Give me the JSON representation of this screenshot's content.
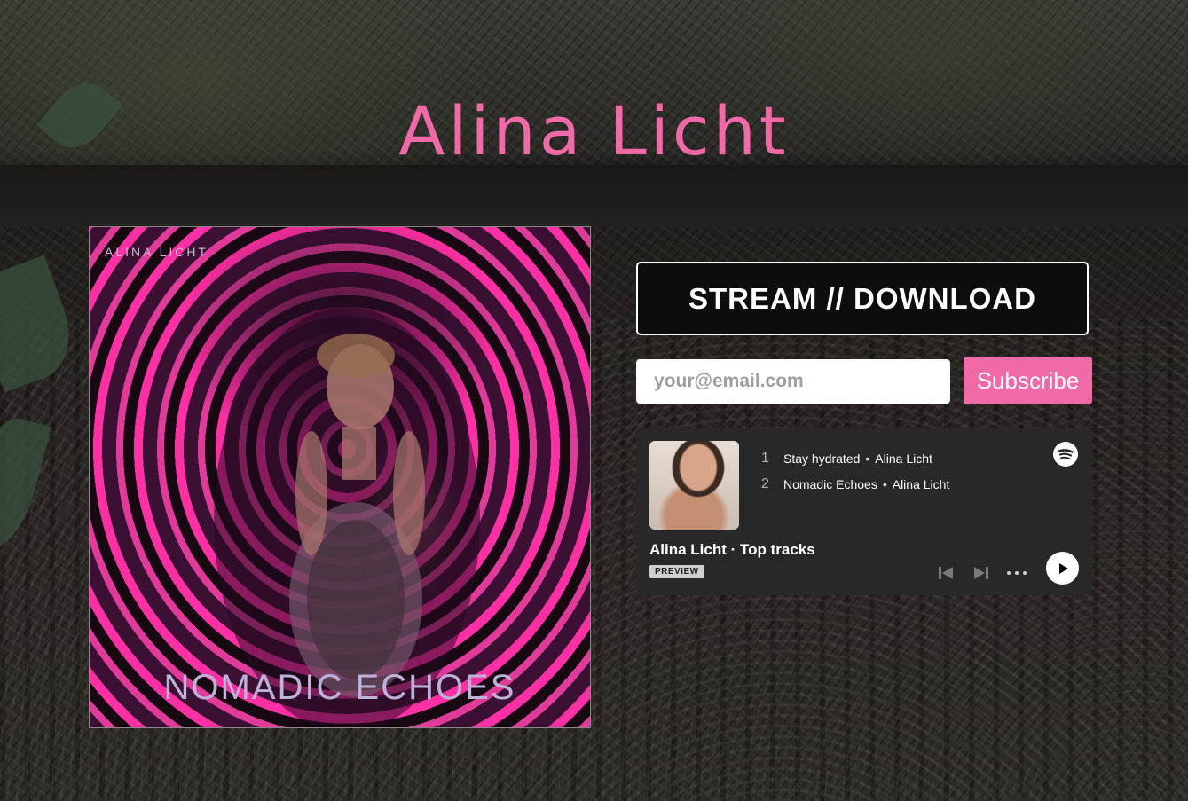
{
  "page": {
    "title": "Alina Licht"
  },
  "album": {
    "artist": "ALINA LICHT",
    "title": "NOMADIC ECHOES"
  },
  "stream_button": {
    "label": "STREAM // DOWNLOAD"
  },
  "subscribe": {
    "email_placeholder": "your@email.com",
    "button_label": "Subscribe"
  },
  "player": {
    "title": "Alina Licht · Top tracks",
    "badge": "PREVIEW",
    "tracks": [
      {
        "number": "1",
        "name": "Stay hydrated",
        "artist": "Alina Licht"
      },
      {
        "number": "2",
        "name": "Nomadic Echoes",
        "artist": "Alina Licht"
      }
    ],
    "icons": [
      "spotify-icon",
      "previous-track-icon",
      "next-track-icon",
      "more-options-icon",
      "play-icon"
    ]
  },
  "colors": {
    "accent": "#f06aa8",
    "player_bg": "#282828",
    "button_bg": "#0d0d0d"
  }
}
